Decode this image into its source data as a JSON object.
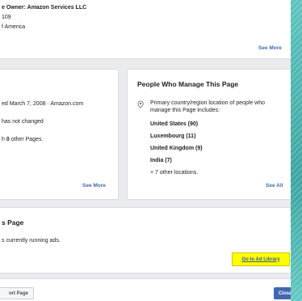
{
  "info_card": {
    "owner_line": "e Owner: Amazon Services LLC",
    "line2": "109",
    "line3": "f America",
    "see_more": "See More"
  },
  "history_card": {
    "created_line": "ed March 7, 2008 · Amazon.com",
    "name_line": "has not changed",
    "merged_line_prefix": "h ",
    "merged_count": "0",
    "merged_line_suffix": " other Pages.",
    "see_more": "See More"
  },
  "managers_card": {
    "title": "People Who Manage This Page",
    "description_line1": "Primary country/region location of people who",
    "description_line2": "manage this Page includes:",
    "locations": [
      "United States (90)",
      "Luxembourg (11)",
      "United Kingdom (9)",
      "India (7)"
    ],
    "more_locations": "+ 7 other locations.",
    "see_all": "See All"
  },
  "ads_card": {
    "title": "s Page",
    "status": "s currently running ads.",
    "ad_library_button": "Go to Ad Library"
  },
  "footer": {
    "report_button": "ort Page",
    "close_button": "Close"
  },
  "colors": {
    "link": "#4267b2",
    "highlight": "#ffff00",
    "background": "#e9ebee"
  },
  "icons": {
    "location": "map-pin-icon"
  }
}
